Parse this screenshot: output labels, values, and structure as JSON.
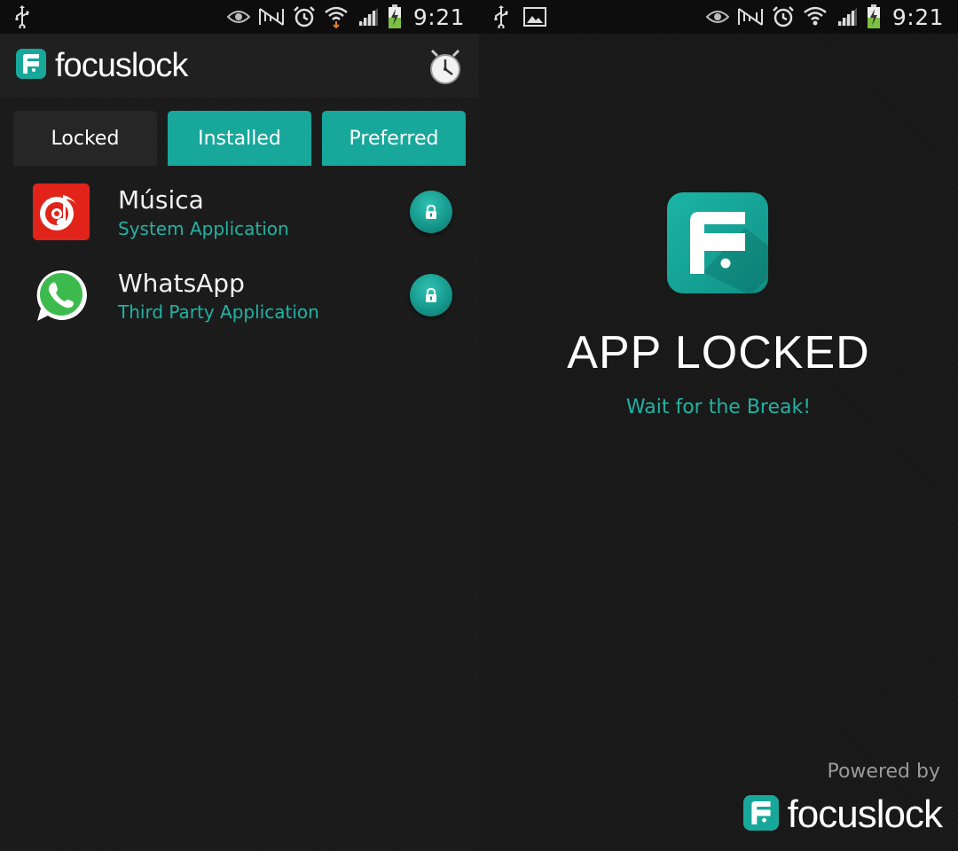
{
  "colors": {
    "accent": "#17a89b",
    "subtitle": "#1fb3a4",
    "background": "#1a1a1a"
  },
  "status_bar": {
    "time": "9:21",
    "left_screen_icons": [
      "usb-icon"
    ],
    "right_screen_icons": [
      "usb-icon",
      "image-icon"
    ],
    "system_icons": [
      "eye-icon",
      "nfc-icon",
      "alarm-icon",
      "wifi-icon",
      "signal-icon",
      "battery-charging-icon"
    ]
  },
  "left": {
    "brand": {
      "name": "focuslock",
      "logo_icon": "focuslock-logo-icon"
    },
    "timer_icon": "stopwatch-icon",
    "tabs": [
      {
        "label": "Locked",
        "active": false
      },
      {
        "label": "Installed",
        "active": true
      },
      {
        "label": "Preferred",
        "active": true
      }
    ],
    "apps": [
      {
        "name": "Música",
        "type": "System Application",
        "icon": "music-app-icon",
        "action_icon": "lock-icon"
      },
      {
        "name": "WhatsApp",
        "type": "Third Party Application",
        "icon": "whatsapp-icon",
        "action_icon": "lock-icon"
      }
    ]
  },
  "right": {
    "logo_icon": "focuslock-logo-icon",
    "title": "APP LOCKED",
    "subtitle": "Wait for the Break!",
    "powered_by": "Powered by",
    "brand_name": "focuslock"
  }
}
